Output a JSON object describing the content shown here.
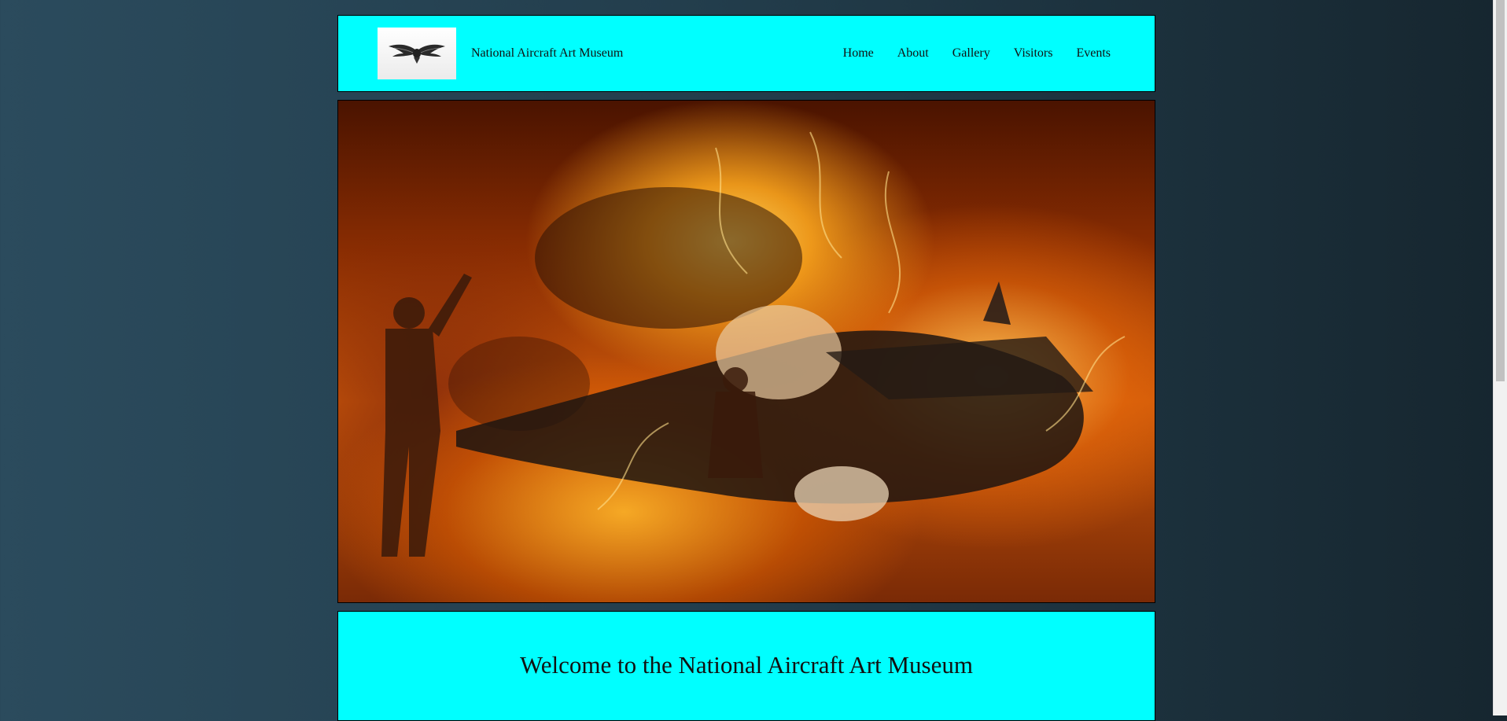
{
  "colors": {
    "panel": "#00ffff",
    "page_bg": "#233e4d"
  },
  "header": {
    "logo_icon": "winged-emblem-icon",
    "site_name": "National Aircraft Art Museum",
    "nav": [
      {
        "label": "Home",
        "name": "nav-home"
      },
      {
        "label": "About",
        "name": "nav-about"
      },
      {
        "label": "Gallery",
        "name": "nav-gallery"
      },
      {
        "label": "Visitors",
        "name": "nav-visitors"
      },
      {
        "label": "Events",
        "name": "nav-events"
      }
    ]
  },
  "hero": {
    "image": "fiery-aircraft-carrier-artwork"
  },
  "welcome": {
    "heading": "Welcome to the National Aircraft Art Museum"
  }
}
